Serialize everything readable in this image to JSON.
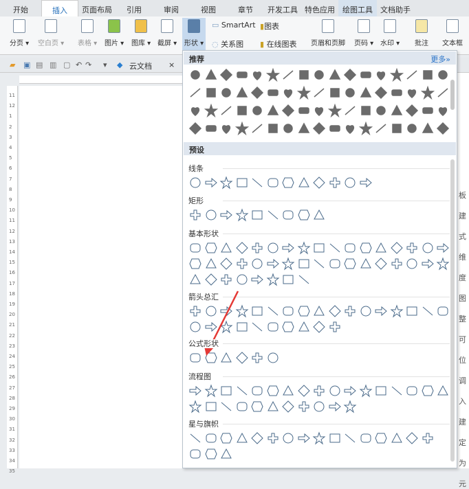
{
  "tabs": [
    "开始",
    "插入",
    "页面布局",
    "引用",
    "审阅",
    "视图",
    "章节",
    "开发工具",
    "特色应用",
    "绘图工具",
    "文档助手"
  ],
  "ribbon": {
    "page_break": "分页 ▾",
    "blank_page": "空白页 ▾",
    "table": "表格 ▾",
    "picture": "图片 ▾",
    "gallery": "图库 ▾",
    "screenshot": "截屏 ▾",
    "shapes": "形状 ▾",
    "smartart": "SmartArt",
    "chart": "图表",
    "relation": "关系图",
    "online_chart": "在线图表",
    "header_footer": "页眉和页脚",
    "page_number": "页码 ▾",
    "watermark": "水印 ▾",
    "comment": "批注",
    "textbox": "文本框"
  },
  "quickbar": {
    "cloud_doc": "云文档",
    "close": "×"
  },
  "ruler_numbers": [
    "11",
    "12",
    "1",
    "2",
    "3",
    "4",
    "5",
    "6",
    "7",
    "8",
    "9",
    "10",
    "11",
    "12",
    "13",
    "14",
    "15",
    "16",
    "17",
    "18",
    "19",
    "20",
    "21",
    "22",
    "23",
    "24",
    "25",
    "26",
    "27",
    "28",
    "29",
    "30",
    "31",
    "32",
    "33",
    "34",
    "35"
  ],
  "right_doc_chars": [
    "板",
    "建",
    "式",
    "维",
    "度",
    "图",
    "整",
    "可",
    "位",
    "调",
    "入",
    "建",
    "定",
    "为",
    "元"
  ],
  "panel": {
    "recommended": "推荐",
    "more": "更多»",
    "presets": "预设",
    "categories": [
      {
        "label": "线条",
        "rows": [
          12
        ]
      },
      {
        "label": "矩形",
        "rows": [
          9
        ]
      },
      {
        "label": "基本形状",
        "rows": [
          17,
          17,
          8
        ]
      },
      {
        "label": "箭头总汇",
        "rows": [
          17,
          10
        ]
      },
      {
        "label": "公式形状",
        "rows": [
          6
        ]
      },
      {
        "label": "流程图",
        "rows": [
          17,
          11
        ]
      },
      {
        "label": "星与旗帜",
        "rows": [
          16,
          3
        ]
      }
    ],
    "recommended_rows": [
      17,
      17,
      17,
      17
    ]
  },
  "colors": {
    "accent": "#1e6bb8",
    "arrow": "#e53935",
    "shape_fill": "#6b6b6b",
    "shape_stroke": "#4a6a8a"
  }
}
